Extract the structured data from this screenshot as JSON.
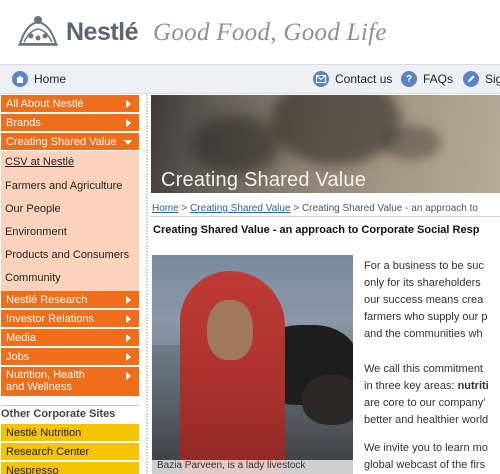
{
  "brand": {
    "name": "Nestlé",
    "tagline": "Good Food, Good Life"
  },
  "topnav": {
    "home": "Home",
    "contact": "Contact us",
    "faqs": "FAQs",
    "sign": "Sig"
  },
  "colors": {
    "nav_orange": "#f06d1a",
    "nav_peach": "#fbd3bd",
    "nav_yellow": "#f5c400",
    "link_blue": "#2b5fa8",
    "icon_blue": "#5b84c4"
  },
  "leftnav": {
    "items": [
      "All About Nestlé",
      "Brands",
      "Creating Shared Value"
    ],
    "sub_items": [
      "CSV at Nestlé",
      "Farmers and Agriculture",
      "Our People",
      "Environment",
      "Products and Consumers",
      "Community"
    ],
    "more_items": [
      "Nestlé Research",
      "Investor Relations",
      "Media",
      "Jobs"
    ],
    "tall_item_line1": "Nutrition, Health",
    "tall_item_line2": "and Wellness",
    "other_title": "Other Corporate Sites",
    "other_sites": [
      "Nestlé Nutrition",
      "Research Center",
      "Nespresso"
    ]
  },
  "hero": {
    "title": "Creating Shared Value"
  },
  "breadcrumb": {
    "home": "Home",
    "sep1": ">",
    "csv": "Creating Shared Value",
    "sep2": ">",
    "current": "Creating Shared Value - an approach to"
  },
  "page_heading": "Creating Shared Value - an approach to Corporate Social Resp",
  "photo_caption": "Bazia Parveen, is a lady livestock",
  "paragraphs": {
    "p1": [
      "For a business to be suc",
      "only for its shareholders",
      "our success means crea",
      "farmers who supply our p",
      "and the communities wh"
    ],
    "p2_line1": "We call this commitment",
    "p2_line2_pre": "in three key areas: ",
    "p2_line2_bold": "nutriti",
    "p2_lines_rest": [
      "are core to our company'",
      "better and healthier world"
    ],
    "p3": [
      "We invite you to learn mo",
      "global webcast of the firs"
    ]
  }
}
